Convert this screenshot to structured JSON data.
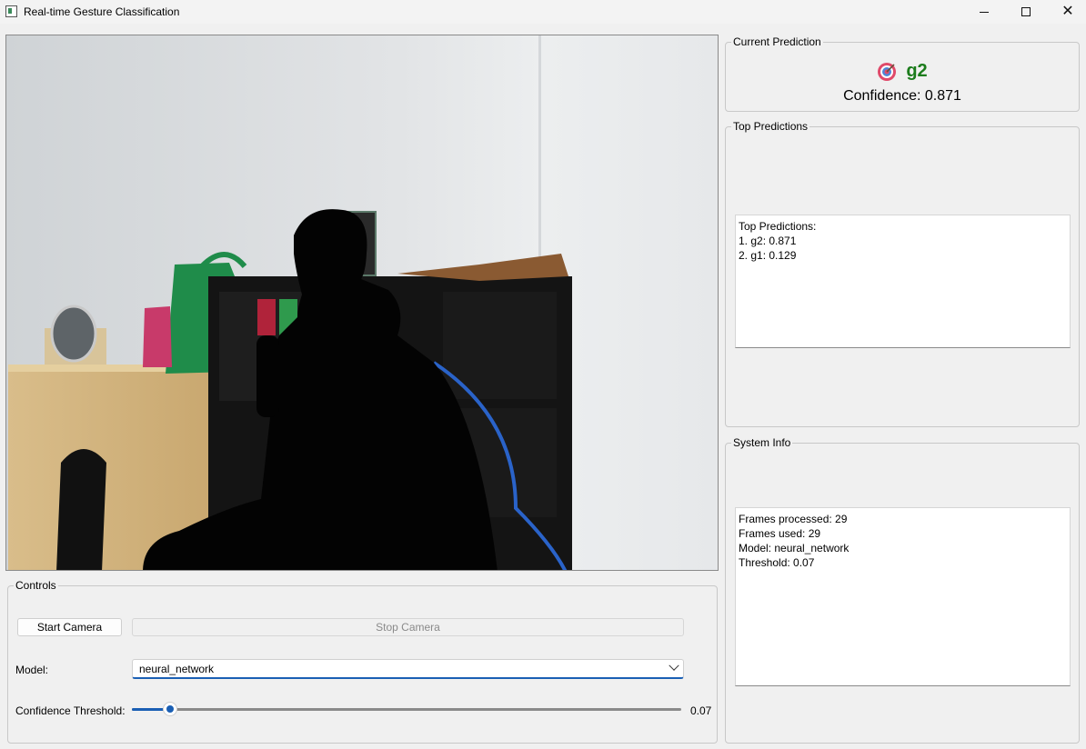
{
  "window": {
    "title": "Real-time Gesture Classification",
    "min_symbol": "—",
    "max_symbol": "☐",
    "close_symbol": "✕"
  },
  "camera": {
    "icon": "webcam-feed"
  },
  "controls": {
    "title": "Controls",
    "start_label": "Start Camera",
    "stop_label": "Stop Camera",
    "model_label": "Model:",
    "model_value": "neural_network",
    "confidence_label": "Confidence Threshold:",
    "threshold_value": "0.07",
    "threshold_fraction": 0.07
  },
  "current": {
    "title": "Current Prediction",
    "icon": "target-icon",
    "label": "g2",
    "confidence": "Confidence: 0.871",
    "label_color": "#1c7c1c"
  },
  "top": {
    "title": "Top Predictions",
    "lines": [
      "Top Predictions:",
      "1. g2: 0.871",
      "2. g1: 0.129"
    ]
  },
  "system": {
    "title": "System Info",
    "lines": [
      "Frames processed: 29",
      "Frames used: 29",
      "Model: neural_network",
      "Threshold: 0.07"
    ]
  },
  "colors": {
    "accent": "#1a5fb4",
    "background": "#f0f0f0"
  }
}
